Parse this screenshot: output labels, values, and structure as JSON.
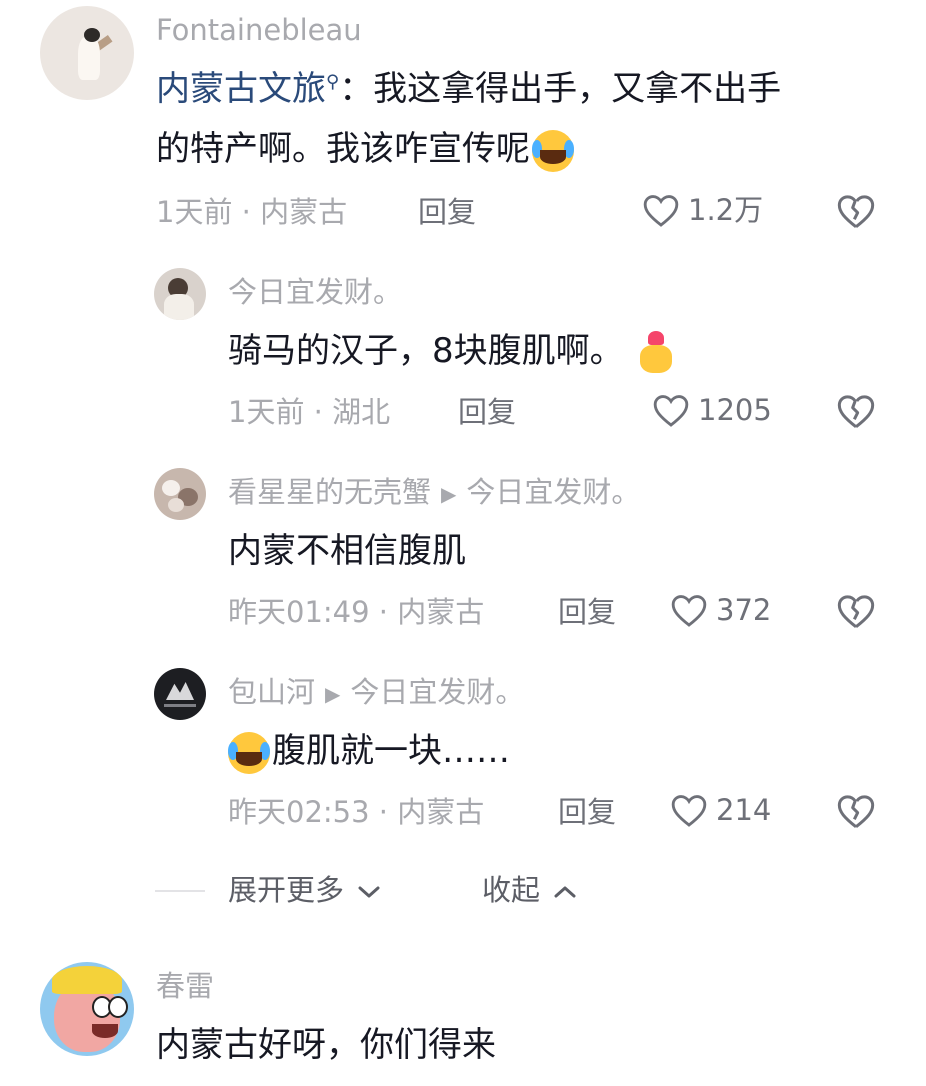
{
  "comments": [
    {
      "user": "Fontainebleau",
      "mention": "内蒙古文旅",
      "mention_icon": "search-icon",
      "text_line1": "：我这拿得出手，又拿不出手",
      "text_line2": "的特产啊。我该咋宣传呢",
      "emoji": "rolling-laughing-emoji",
      "meta": "1天前 · 内蒙古",
      "reply_label": "回复",
      "likes": "1.2万"
    },
    {
      "user": "春雷",
      "text": "内蒙古好呀，你们得来"
    }
  ],
  "replies": [
    {
      "user": "今日宜发财。",
      "text": "骑马的汉子，8块腹肌啊。",
      "emoji": "finger-heart-emoji",
      "meta": "1天前 · 湖北",
      "reply_label": "回复",
      "likes": "1205"
    },
    {
      "user": "看星星的无壳蟹",
      "reply_to": "今日宜发财。",
      "text": "内蒙不相信腹肌",
      "meta": "昨天01:49 · 内蒙古",
      "reply_label": "回复",
      "likes": "372"
    },
    {
      "user": "包山河",
      "reply_to": "今日宜发财。",
      "text": "腹肌就一块……",
      "emoji": "rolling-laughing-emoji",
      "meta": "昨天02:53 · 内蒙古",
      "reply_label": "回复",
      "likes": "214"
    }
  ],
  "expand_more": "展开更多",
  "collapse": "收起",
  "colors": {
    "name": "#a8a9ae",
    "mention": "#2a4a7a",
    "text": "#161823",
    "action": "#6e7078"
  }
}
